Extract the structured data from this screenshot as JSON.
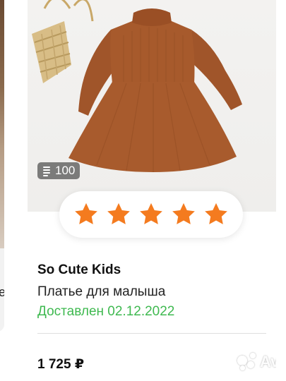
{
  "left_card": {
    "cut_text": "е."
  },
  "product": {
    "views_count": "100",
    "rating_stars": 5,
    "rating_max": 5,
    "seller": "So Cute Kids",
    "title": "Платье для малыша",
    "status": "Доставлен 02.12.2022",
    "price": "1 725 ₽"
  },
  "watermark": {
    "text": "Avito"
  },
  "colors": {
    "star": "#f47b1f",
    "status_green": "#3fb950",
    "dress": "#a75a2c"
  },
  "icons": [
    "document-icon",
    "star-icon",
    "avito-logo"
  ]
}
